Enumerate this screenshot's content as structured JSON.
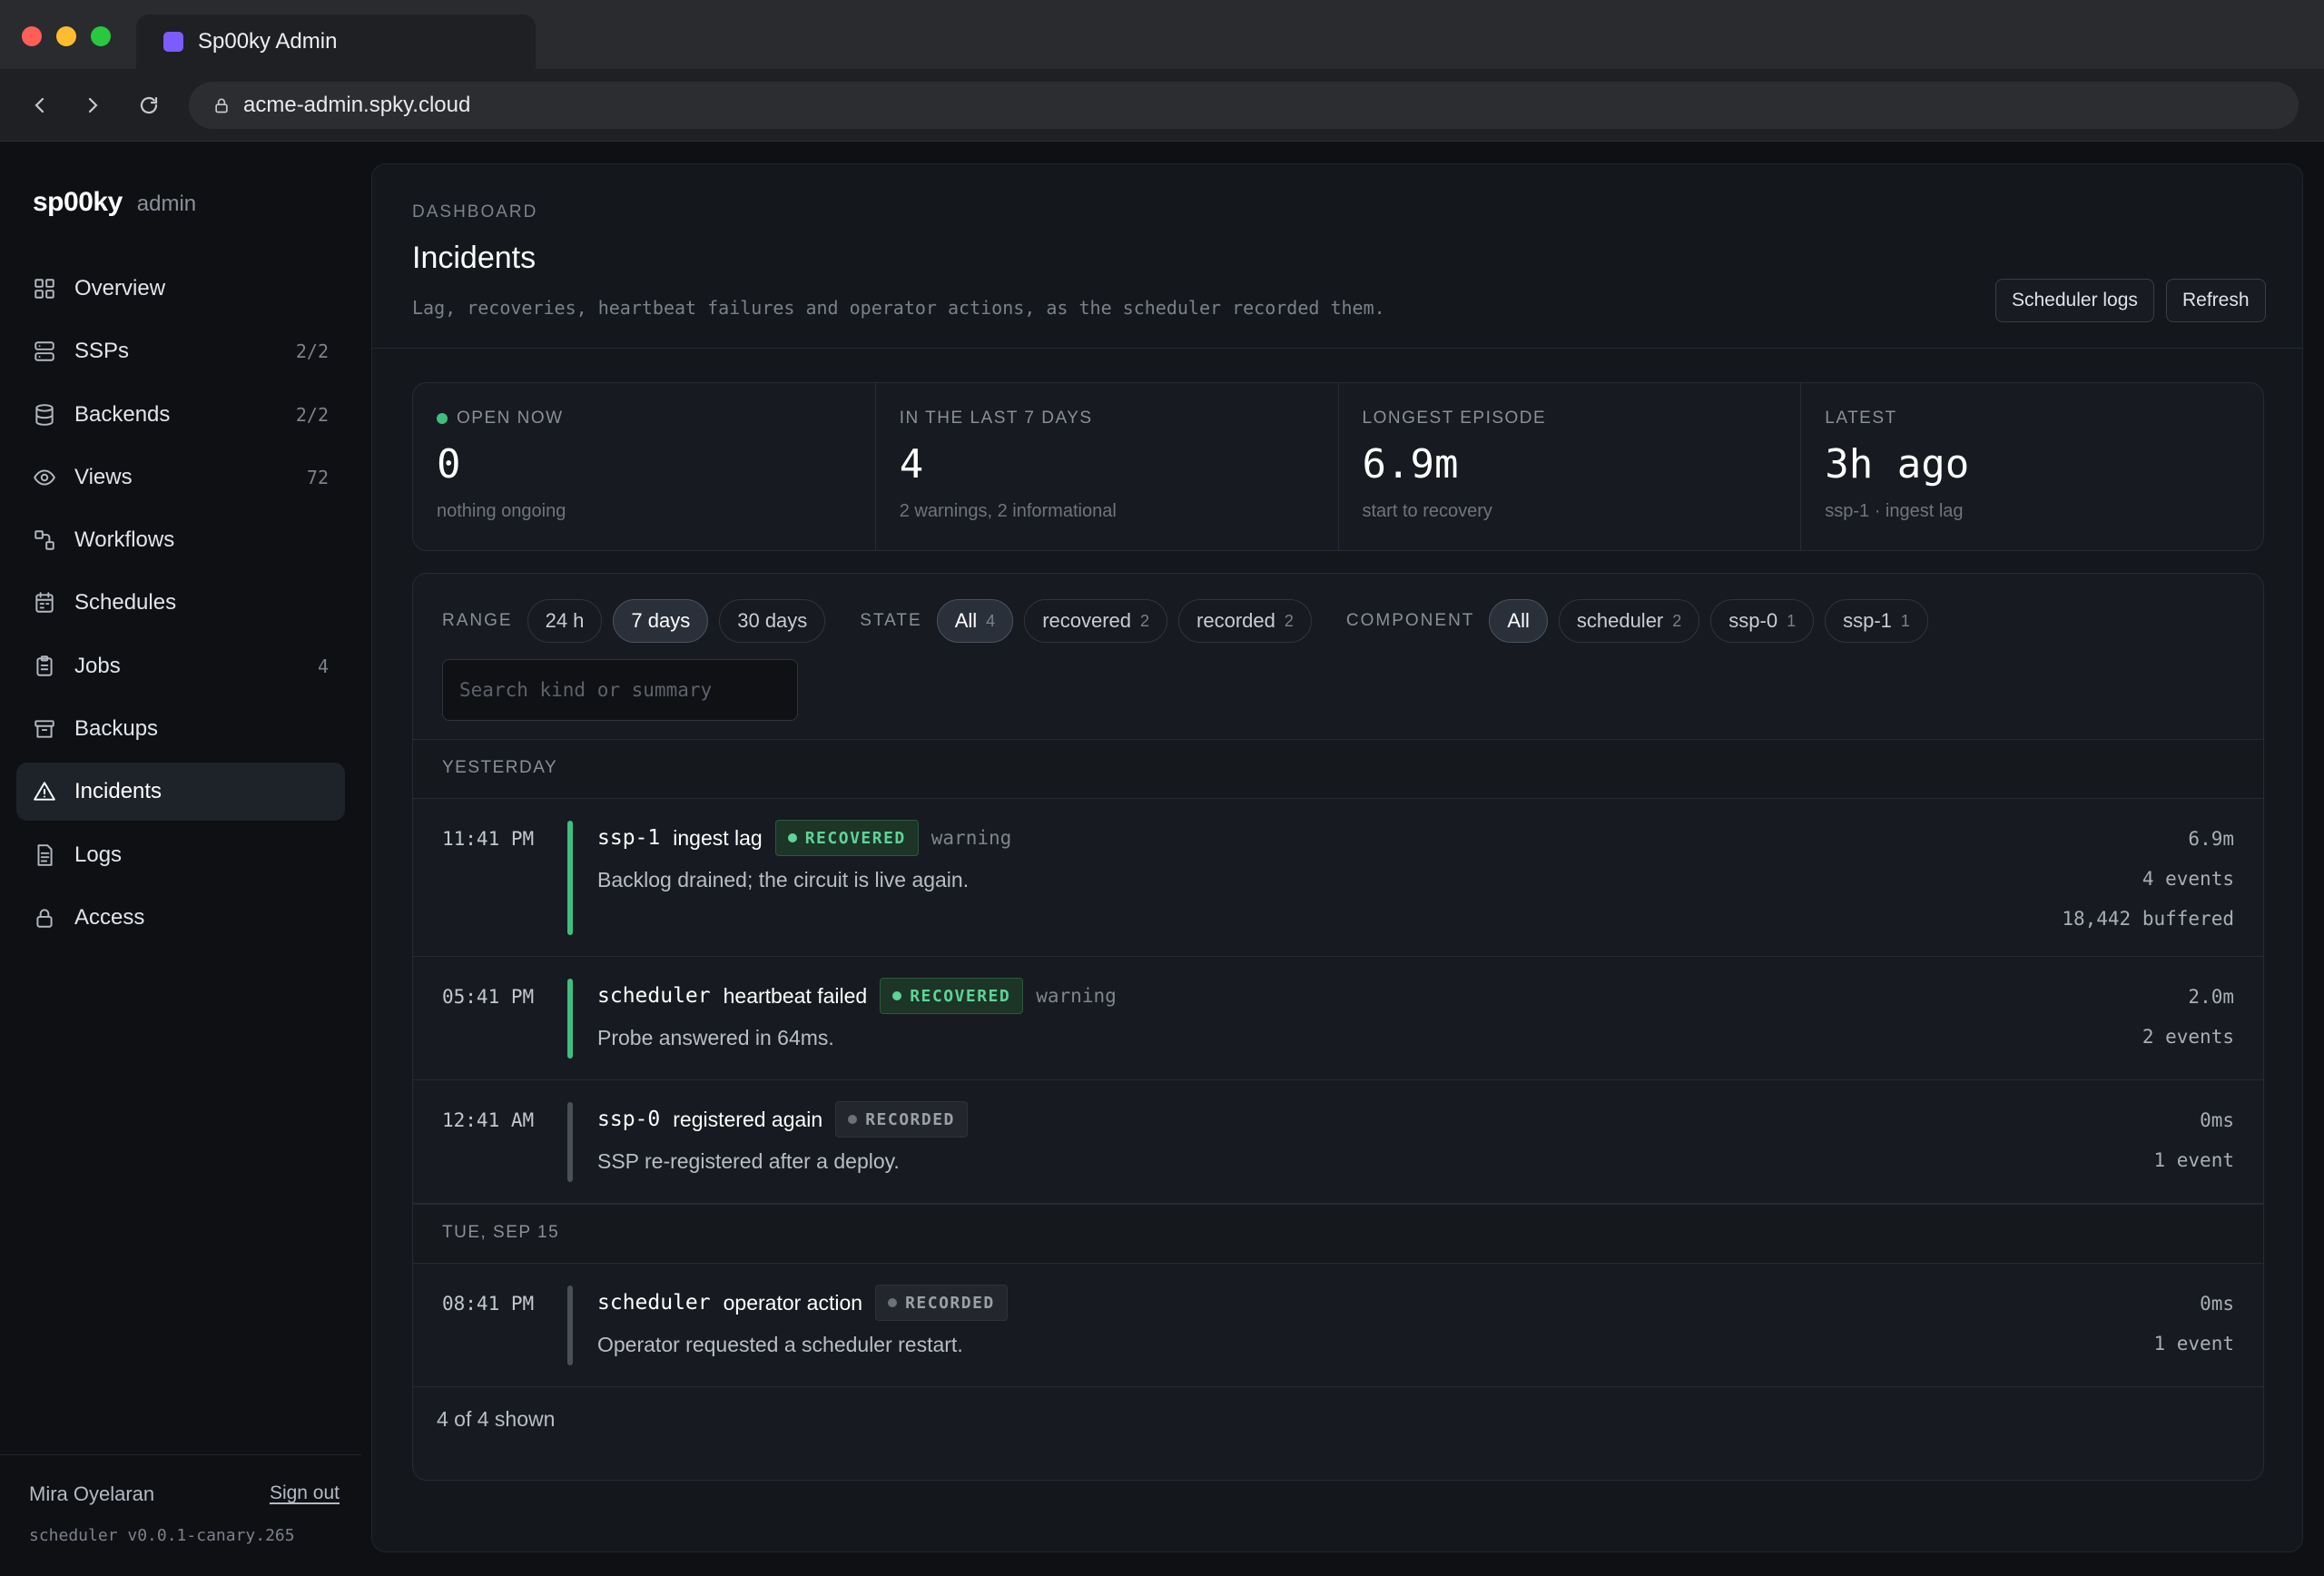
{
  "browser": {
    "tab_title": "Sp00ky Admin",
    "url": "acme-admin.spky.cloud"
  },
  "sidebar": {
    "logo": "sp00ky",
    "logo_suffix": "admin",
    "items": [
      {
        "label": "Overview",
        "count": "",
        "icon": "grid-icon"
      },
      {
        "label": "SSPs",
        "count": "2/2",
        "icon": "server-icon"
      },
      {
        "label": "Backends",
        "count": "2/2",
        "icon": "database-icon"
      },
      {
        "label": "Views",
        "count": "72",
        "icon": "eye-icon"
      },
      {
        "label": "Workflows",
        "count": "",
        "icon": "workflow-icon"
      },
      {
        "label": "Schedules",
        "count": "",
        "icon": "calendar-icon"
      },
      {
        "label": "Jobs",
        "count": "4",
        "icon": "clipboard-icon"
      },
      {
        "label": "Backups",
        "count": "",
        "icon": "archive-icon"
      },
      {
        "label": "Incidents",
        "count": "",
        "icon": "warning-icon",
        "active": true
      },
      {
        "label": "Logs",
        "count": "",
        "icon": "document-icon"
      },
      {
        "label": "Access",
        "count": "",
        "icon": "lock-icon"
      }
    ],
    "user_name": "Mira Oyelaran",
    "sign_out": "Sign out",
    "version": "scheduler v0.0.1-canary.265"
  },
  "header": {
    "breadcrumb": "DASHBOARD",
    "title": "Incidents",
    "subtitle": "Lag, recoveries, heartbeat failures and operator actions, as the scheduler recorded them.",
    "scheduler_logs_label": "Scheduler logs",
    "refresh_label": "Refresh"
  },
  "stats": [
    {
      "label": "OPEN NOW",
      "value": "0",
      "note": "nothing ongoing"
    },
    {
      "label": "IN THE LAST 7 DAYS",
      "value": "4",
      "note": "2 warnings, 2 informational"
    },
    {
      "label": "LONGEST EPISODE",
      "value": "6.9m",
      "note": "start to recovery"
    },
    {
      "label": "LATEST",
      "value": "3h ago",
      "note": "ssp-1 · ingest lag"
    }
  ],
  "filters": {
    "range_label": "RANGE",
    "range": [
      {
        "label": "24 h",
        "active": false
      },
      {
        "label": "7 days",
        "active": true
      },
      {
        "label": "30 days",
        "active": false
      }
    ],
    "state_label": "STATE",
    "state": [
      {
        "label": "All",
        "count": "4",
        "active": true
      },
      {
        "label": "recovered",
        "count": "2",
        "active": false
      },
      {
        "label": "recorded",
        "count": "2",
        "active": false
      }
    ],
    "component_label": "COMPONENT",
    "component": [
      {
        "label": "All",
        "count": "",
        "active": true
      },
      {
        "label": "scheduler",
        "count": "2",
        "active": false
      },
      {
        "label": "ssp-0",
        "count": "1",
        "active": false
      },
      {
        "label": "ssp-1",
        "count": "1",
        "active": false
      }
    ],
    "search_placeholder": "Search kind or summary"
  },
  "groups": [
    {
      "label": "YESTERDAY",
      "incidents": [
        {
          "time": "11:41 PM",
          "component": "ssp-1",
          "kind": "ingest lag",
          "state": "RECOVERED",
          "severity": "warning",
          "summary": "Backlog drained; the circuit is live again.",
          "duration": "6.9m",
          "events": "4 events",
          "extra": "18,442 buffered"
        },
        {
          "time": "05:41 PM",
          "component": "scheduler",
          "kind": "heartbeat failed",
          "state": "RECOVERED",
          "severity": "warning",
          "summary": "Probe answered in 64ms.",
          "duration": "2.0m",
          "events": "2 events",
          "extra": ""
        },
        {
          "time": "12:41 AM",
          "component": "ssp-0",
          "kind": "registered again",
          "state": "RECORDED",
          "severity": "",
          "summary": "SSP re-registered after a deploy.",
          "duration": "0ms",
          "events": "1 event",
          "extra": ""
        }
      ]
    },
    {
      "label": "TUE, SEP 15",
      "incidents": [
        {
          "time": "08:41 PM",
          "component": "scheduler",
          "kind": "operator action",
          "state": "RECORDED",
          "severity": "",
          "summary": "Operator requested a scheduler restart.",
          "duration": "0ms",
          "events": "1 event",
          "extra": ""
        }
      ]
    }
  ],
  "footer": {
    "shown": "4 of 4 shown"
  },
  "colors": {
    "accent_green": "#3fbf7f",
    "tab_favicon": "#7c5cff",
    "background": "#0e1014"
  }
}
